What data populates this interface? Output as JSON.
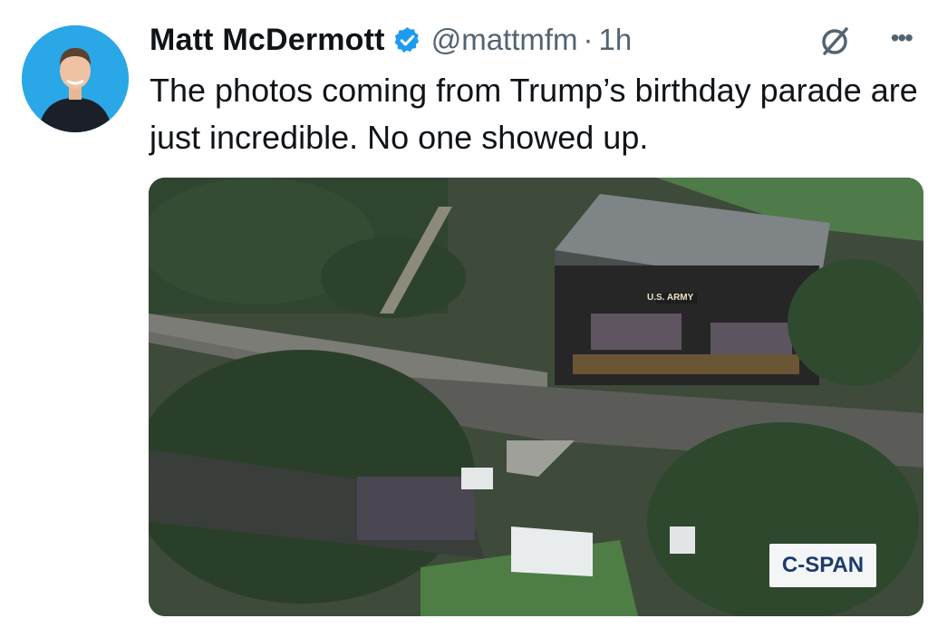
{
  "tweet": {
    "author_name": "Matt McDermott",
    "handle": "@mattmfm",
    "separator": "·",
    "time": "1h",
    "text": "The photos coming from Trump’s birthday parade are just incredible. No one showed up.",
    "more_label": "•••"
  },
  "media": {
    "stage_sign": "U.S. ARMY",
    "watermark": "C-SPAN"
  },
  "icons": {
    "verified": "verified-badge-icon",
    "action": "slash-circle-icon",
    "more": "more-dots-icon"
  },
  "colors": {
    "verified_blue": "#1d9bf0",
    "handle_gray": "#536471",
    "avatar_bg": "#2aa7e6"
  }
}
